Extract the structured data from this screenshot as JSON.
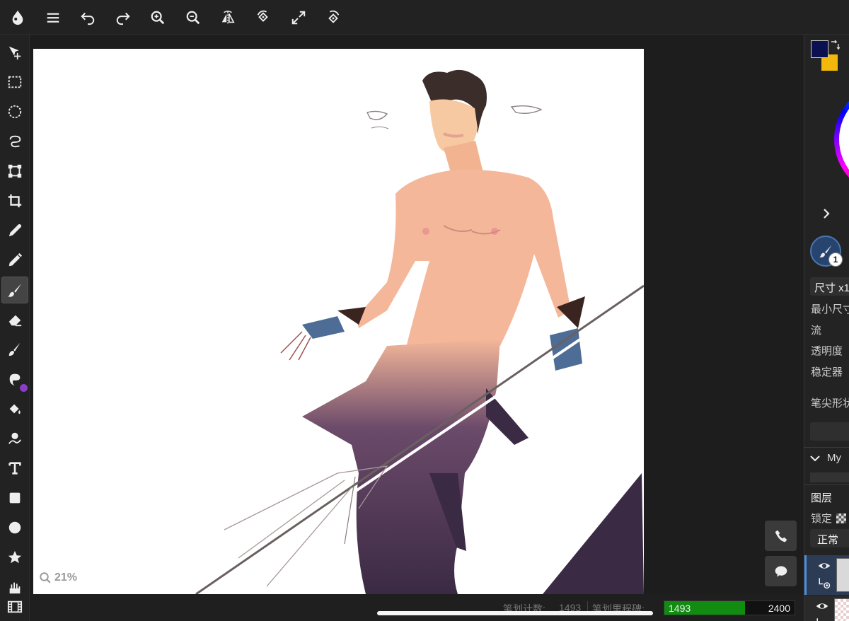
{
  "topbar": {
    "buttons": [
      {
        "name": "app-logo-icon"
      },
      {
        "name": "menu-icon"
      },
      {
        "name": "undo-icon"
      },
      {
        "name": "redo-icon"
      },
      {
        "name": "zoom-in-icon"
      },
      {
        "name": "zoom-out-icon"
      },
      {
        "name": "flip-icon"
      },
      {
        "name": "rotate-left-icon"
      },
      {
        "name": "fit-screen-icon"
      },
      {
        "name": "rotate-right-icon"
      }
    ]
  },
  "tools": [
    {
      "name": "move-tool-icon"
    },
    {
      "name": "rect-select-icon"
    },
    {
      "name": "ellipse-select-icon"
    },
    {
      "name": "lasso-select-icon"
    },
    {
      "name": "transform-icon"
    },
    {
      "name": "crop-icon"
    },
    {
      "name": "eyedropper-icon"
    },
    {
      "name": "pencil-icon"
    },
    {
      "name": "brush-icon",
      "active": true
    },
    {
      "name": "eraser-icon"
    },
    {
      "name": "smudge-icon"
    },
    {
      "name": "blur-icon"
    },
    {
      "name": "fill-bucket-icon"
    },
    {
      "name": "magic-wand-icon"
    },
    {
      "name": "text-icon"
    },
    {
      "name": "rectangle-icon"
    },
    {
      "name": "circle-icon"
    },
    {
      "name": "star-icon"
    },
    {
      "name": "hand-icon"
    },
    {
      "name": "film-icon"
    }
  ],
  "canvas": {
    "zoom": "21%"
  },
  "status": {
    "stroke_count_label": "笔划计数:",
    "stroke_count_value": "1493",
    "stroke_milestone_label": "笔划里程碑:",
    "progress_value": "1493",
    "progress_max": "2400",
    "progress_fraction": 0.622
  },
  "colors": {
    "foreground": "#0b1050",
    "background": "#f2b90c",
    "progress": "#118c11"
  },
  "panel": {
    "brush_badge": "1",
    "size_label": "尺寸 x1",
    "min_size_label": "最小尺寸",
    "flow_label": "流",
    "opacity_label": "透明度",
    "stabilizer_label": "稳定器",
    "tip_shape_label": "笔尖形状",
    "brush_group": "My",
    "layers_title": "图层",
    "lock_label": "锁定",
    "blend_mode": "正常"
  }
}
